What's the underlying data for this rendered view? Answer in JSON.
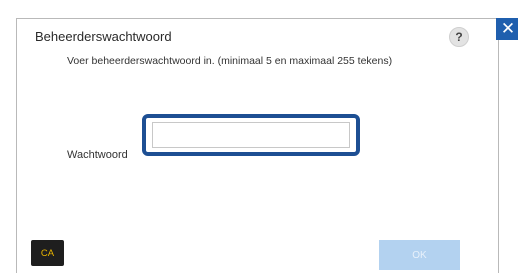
{
  "dialog": {
    "title": "Beheerderswachtwoord",
    "help_glyph": "?",
    "close_glyph": "✕",
    "instruction": "Voer beheerderswachtwoord in. (minimaal 5 en maximaal 255 tekens)"
  },
  "password_field": {
    "label": "Wachtwoord",
    "value": "",
    "placeholder": ""
  },
  "footer": {
    "ca_label": "CA",
    "ok_label": "OK",
    "ok_enabled": false
  },
  "colors": {
    "close_button": "#1f5fae",
    "focus_ring": "#1d4f93",
    "ca_background": "#1e1e1e",
    "ca_text": "#e8b400",
    "ok_disabled": "#b3d2f0"
  },
  "icons": {
    "help": "question-mark-icon",
    "close": "close-icon"
  }
}
